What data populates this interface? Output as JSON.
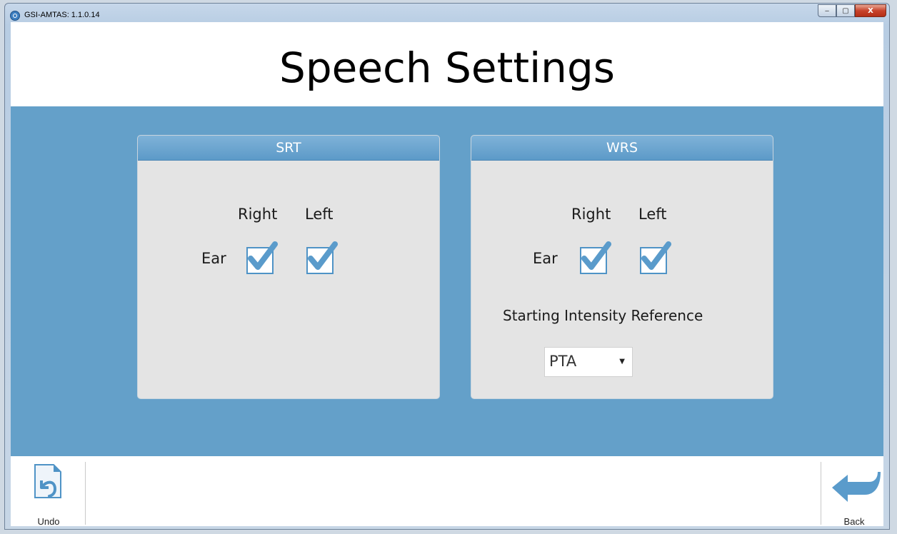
{
  "window": {
    "title": "GSI-AMTAS: 1.1.0.14",
    "controls": {
      "minimize": "‒",
      "maximize": "▢",
      "close": "X"
    }
  },
  "page": {
    "title": "Speech Settings"
  },
  "srt": {
    "header": "SRT",
    "right_label": "Right",
    "left_label": "Left",
    "row_label": "Ear",
    "right_checked": true,
    "left_checked": true
  },
  "wrs": {
    "header": "WRS",
    "right_label": "Right",
    "left_label": "Left",
    "row_label": "Ear",
    "right_checked": true,
    "left_checked": true,
    "intensity_label": "Starting Intensity Reference",
    "intensity_value": "PTA"
  },
  "toolbar": {
    "undo_label": "Undo",
    "back_label": "Back"
  },
  "colors": {
    "band": "#64a0c9",
    "panel": "#e4e4e4",
    "header": "#5c9ac8",
    "check": "#5a9bcb"
  },
  "icons": {
    "undo": "undo-icon",
    "back": "back-arrow-icon",
    "check": "checkmark-icon"
  }
}
